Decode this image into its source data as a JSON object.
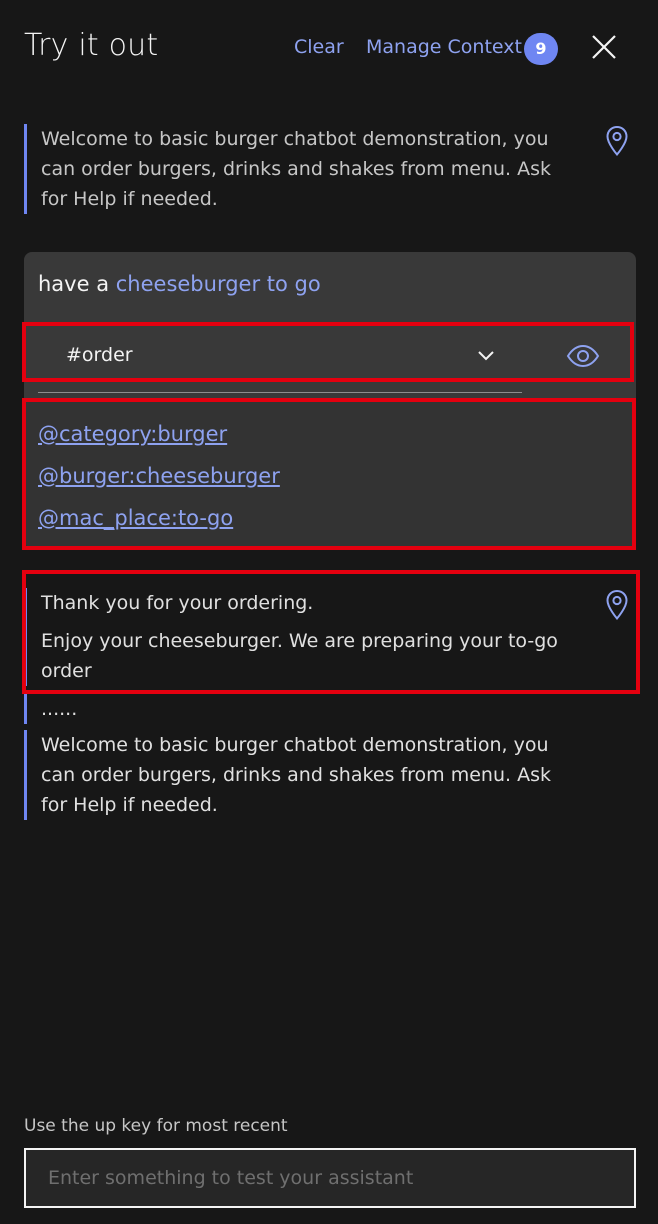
{
  "header": {
    "title": "Try it out",
    "clear_label": "Clear",
    "manage_context_label": "Manage Context",
    "context_count": "9"
  },
  "conversation": {
    "welcome_1": {
      "line1": "Welcome to basic burger chatbot demonstration, you",
      "line2": "can order burgers, drinks and shakes from menu. Ask",
      "line3": "for Help if needed."
    },
    "user_input": {
      "prefix": "have a ",
      "highlight": "cheeseburger to go"
    },
    "intent": "#order",
    "entities": [
      "@category:burger",
      "@burger:cheeseburger",
      "@mac_place:to-go"
    ],
    "reply": {
      "line1": "Thank you for your ordering.",
      "line2": "Enjoy your cheeseburger. We are preparing your to-go",
      "line3": "order"
    },
    "ellipsis": "......",
    "welcome_2": {
      "line1": "Welcome to basic burger chatbot demonstration, you",
      "line2": "can order burgers, drinks and shakes from menu. Ask",
      "line3": "for Help if needed."
    }
  },
  "composer": {
    "hint": "Use the up key for most recent",
    "placeholder": "Enter something to test your assistant"
  },
  "colors": {
    "background": "#171717",
    "accent": "#8ea2f0",
    "badge": "#6f86f2",
    "card": "#393939",
    "highlight_border": "#e4000f"
  },
  "icons": {
    "close": "close-icon",
    "location": "location-pin-icon",
    "chevron": "chevron-down-icon",
    "eye": "eye-icon"
  }
}
